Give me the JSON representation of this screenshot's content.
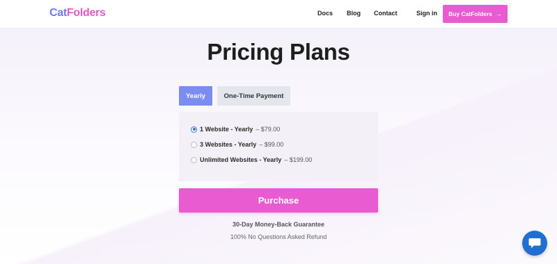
{
  "header": {
    "logo_part1": "Cat",
    "logo_part2": "Folders",
    "nav": [
      "Docs",
      "Blog",
      "Contact",
      "Sign in"
    ],
    "buy_label": "Buy CatFolders",
    "buy_arrow": "→"
  },
  "main": {
    "title": "Pricing Plans",
    "tabs": [
      {
        "label": "Yearly",
        "active": true
      },
      {
        "label": "One-Time Payment",
        "active": false
      }
    ],
    "options": [
      {
        "name": "1 Website - Yearly",
        "price": "– $79.00",
        "selected": true
      },
      {
        "name": "3 Websites - Yearly",
        "price": "– $99.00",
        "selected": false
      },
      {
        "name": "Unlimited Websites - Yearly",
        "price": "– $199.00",
        "selected": false
      }
    ],
    "purchase_label": "Purchase",
    "guarantee": "30-Day Money-Back Guarantee",
    "refund": "100% No Questions Asked Refund"
  },
  "colors": {
    "brand_blue": "#6b7bf0",
    "brand_pink": "#e85ac8",
    "button_pink": "#e95bd0",
    "tab_active": "#7b8df0",
    "chat_blue": "#1f6fd0"
  },
  "icons": {
    "buy_arrow": "arrow-right-icon",
    "chat": "chat-bubble-icon"
  }
}
